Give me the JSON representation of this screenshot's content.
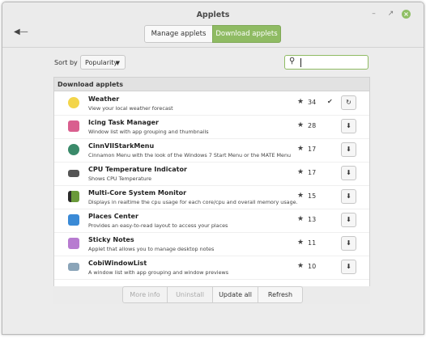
{
  "window": {
    "title": "Applets"
  },
  "header": {
    "back_icon": "back-arrow-icon",
    "tabs": [
      {
        "label": "Manage applets",
        "active": false
      },
      {
        "label": "Download applets",
        "active": true
      }
    ],
    "accent": "#8fbb63"
  },
  "toolbar": {
    "sort_label": "Sort by",
    "sort_value": "Popularity",
    "search_placeholder": "",
    "search_value": ""
  },
  "list": {
    "title": "Download applets",
    "items": [
      {
        "name": "Weather",
        "desc": "View your local weather forecast",
        "score": "34",
        "installed": true,
        "action_icon": "refresh-icon",
        "icon_color": "#f3d54a"
      },
      {
        "name": "Icing Task Manager",
        "desc": "Window list with app grouping and thumbnails",
        "score": "28",
        "installed": false,
        "action_icon": "download-icon",
        "icon_color": "#d95f8f"
      },
      {
        "name": "CinnVIIStarkMenu",
        "desc": "Cinnamon Menu with the look of the Windows 7 Start Menu or the MATE Menu",
        "score": "17",
        "installed": false,
        "action_icon": "download-icon",
        "icon_color": "#3a8a6a"
      },
      {
        "name": "CPU Temperature Indicator",
        "desc": "Shows CPU Temperature",
        "score": "17",
        "installed": false,
        "action_icon": "download-icon",
        "icon_color": "#555555"
      },
      {
        "name": "Multi-Core System Monitor",
        "desc": "Displays in realtime the cpu usage for each core/cpu and overall memory usage.",
        "score": "15",
        "installed": false,
        "action_icon": "download-icon",
        "icon_color": "#6a9a3a"
      },
      {
        "name": "Places Center",
        "desc": "Provides an easy-to-read layout to access your places",
        "score": "13",
        "installed": false,
        "action_icon": "download-icon",
        "icon_color": "#3a8ad6"
      },
      {
        "name": "Sticky Notes",
        "desc": "Applet that allows you to manage desktop notes",
        "score": "11",
        "installed": false,
        "action_icon": "download-icon",
        "icon_color": "#b77bd0"
      },
      {
        "name": "CobiWindowList",
        "desc": "A window list with app grouping and window previews",
        "score": "10",
        "installed": false,
        "action_icon": "download-icon",
        "icon_color": "#8aa4b8"
      }
    ]
  },
  "footer": {
    "buttons": [
      {
        "label": "More info",
        "enabled": false
      },
      {
        "label": "Uninstall",
        "enabled": false
      },
      {
        "label": "Update all",
        "enabled": true
      },
      {
        "label": "Refresh",
        "enabled": true
      }
    ]
  }
}
